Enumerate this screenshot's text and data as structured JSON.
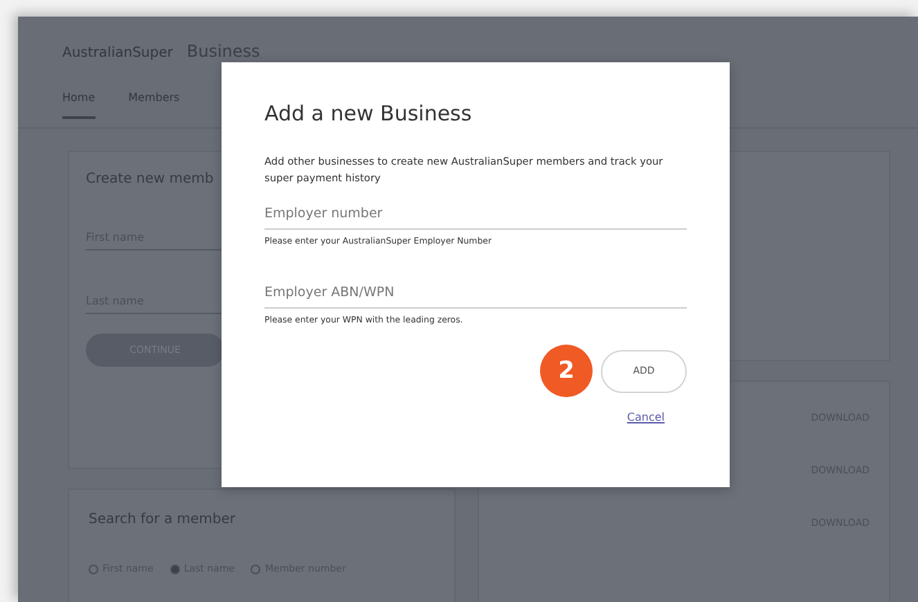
{
  "background": {
    "logo": "AustralianSuper",
    "logo_suffix": "Business",
    "tabs": [
      {
        "label": "Home",
        "selected": true
      },
      {
        "label": "Members",
        "selected": false
      }
    ],
    "create_card": {
      "title": "Create new memb",
      "fields": [
        {
          "placeholder": "First name"
        },
        {
          "placeholder": "Last name"
        }
      ],
      "button": "CONTINUE"
    },
    "search_card": {
      "title": "Search for a member",
      "options": [
        {
          "label": "First name",
          "selected": false
        },
        {
          "label": "Last name",
          "selected": true
        },
        {
          "label": "Member number",
          "selected": false
        }
      ]
    },
    "downloads": [
      {
        "label": "DOWNLOAD"
      },
      {
        "label": "DOWNLOAD"
      },
      {
        "label": "DOWNLOAD"
      }
    ]
  },
  "dialog": {
    "title": "Add a new Business",
    "description": "Add other businesses to create new AustralianSuper members and track your super payment history",
    "fields": [
      {
        "placeholder": "Employer number",
        "hint": "Please enter your AustralianSuper Employer Number"
      },
      {
        "placeholder": "Employer ABN/WPN",
        "hint": "Please enter your WPN with the leading zeros."
      }
    ],
    "step_badge": "2",
    "add_button": "ADD",
    "cancel_link": "Cancel"
  }
}
